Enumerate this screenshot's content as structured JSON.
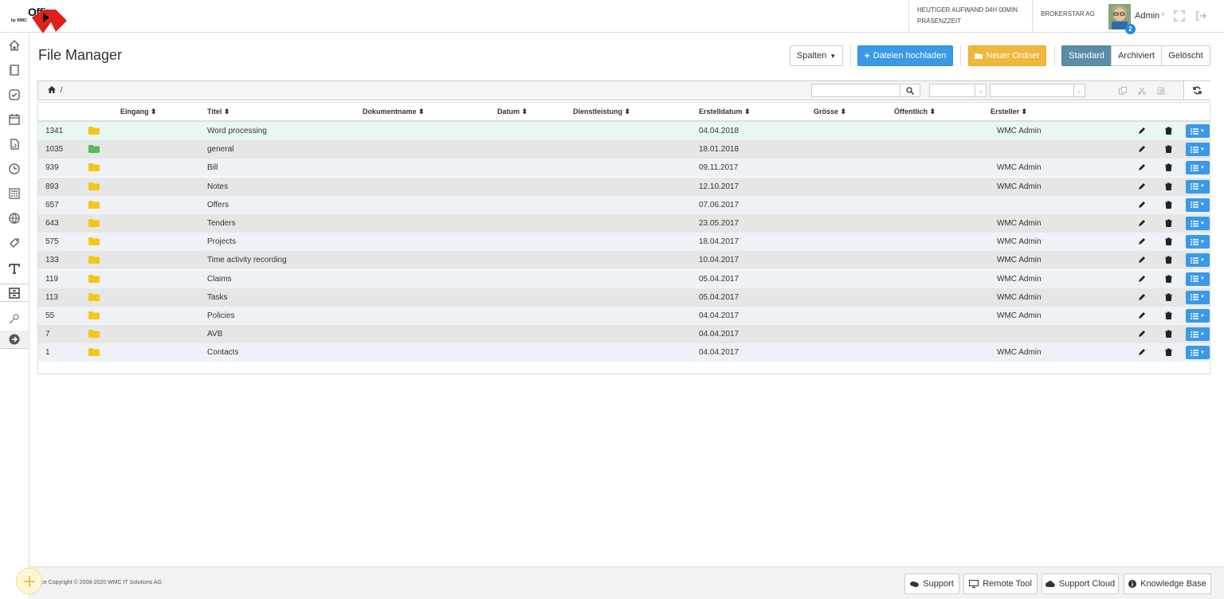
{
  "header": {
    "logo_text": "Office",
    "logo_by": "by WMC",
    "aufwand_line1": "HEUTIGER AUFWAND 04H 00MIN",
    "aufwand_line2": "PRÄSENZZEIT",
    "company": "BROKERSTAR AG",
    "user_name": "Admin",
    "notification_count": "2"
  },
  "page": {
    "title": "File Manager"
  },
  "actions": {
    "columns_label": "Spalten",
    "upload_label": "Dateien hochladen",
    "new_folder_label": "Neuer Ordner",
    "view_tabs": [
      "Standard",
      "Archiviert",
      "Gelöscht"
    ],
    "active_view": "Standard"
  },
  "toolbar": {
    "breadcrumb": "/"
  },
  "table": {
    "columns": {
      "eingang": "Eingang",
      "titel": "Titel",
      "dokumentname": "Dokumentname",
      "datum": "Datum",
      "dienstleistung": "Dienstleistung",
      "erstelldatum": "Erstelldatum",
      "groesse": "Grösse",
      "oeffentlich": "Öffentlich",
      "ersteller": "Ersteller"
    },
    "rows": [
      {
        "id": "1341",
        "title": "Word processing",
        "created": "04.04.2018",
        "creator": "WMC Admin",
        "folder_color": "#f5c518"
      },
      {
        "id": "1035",
        "title": "general",
        "created": "18.01.2018",
        "creator": "",
        "folder_color": "#5cb85c"
      },
      {
        "id": "939",
        "title": "Bill",
        "created": "09.11.2017",
        "creator": "WMC Admin",
        "folder_color": "#f5c518"
      },
      {
        "id": "893",
        "title": "Notes",
        "created": "12.10.2017",
        "creator": "WMC Admin",
        "folder_color": "#f5c518"
      },
      {
        "id": "657",
        "title": "Offers",
        "created": "07.06.2017",
        "creator": "",
        "folder_color": "#f5c518"
      },
      {
        "id": "643",
        "title": "Tenders",
        "created": "23.05.2017",
        "creator": "WMC Admin",
        "folder_color": "#f5c518"
      },
      {
        "id": "575",
        "title": "Projects",
        "created": "18.04.2017",
        "creator": "WMC Admin",
        "folder_color": "#f5c518"
      },
      {
        "id": "133",
        "title": "Time activity recording",
        "created": "10.04.2017",
        "creator": "WMC Admin",
        "folder_color": "#f5c518"
      },
      {
        "id": "119",
        "title": "Claims",
        "created": "05.04.2017",
        "creator": "WMC Admin",
        "folder_color": "#f5c518"
      },
      {
        "id": "113",
        "title": "Tasks",
        "created": "05.04.2017",
        "creator": "WMC Admin",
        "folder_color": "#f5c518"
      },
      {
        "id": "55",
        "title": "Policies",
        "created": "04.04.2017",
        "creator": "WMC Admin",
        "folder_color": "#f5c518"
      },
      {
        "id": "7",
        "title": "AVB",
        "created": "04.04.2017",
        "creator": "",
        "folder_color": "#f5c518"
      },
      {
        "id": "1",
        "title": "Contacts",
        "created": "04.04.2017",
        "creator": "WMC Admin",
        "folder_color": "#f5c518"
      }
    ]
  },
  "footer": {
    "copyright": "iOffice Copyright © 2008-2020 WMC IT Solutions AG",
    "support": "Support",
    "remote_tool": "Remote Tool",
    "support_cloud": "Support Cloud",
    "knowledge_base": "Knowledge Base"
  },
  "sidebar": {
    "icons": [
      "home-icon",
      "notebook-icon",
      "check-icon",
      "calendar-icon",
      "document-refresh-icon",
      "clock-icon",
      "calculator-icon",
      "globe-icon",
      "tag-icon",
      "text-icon",
      "file-manager-icon",
      "key-icon",
      "arrow-right-circle-icon"
    ]
  }
}
